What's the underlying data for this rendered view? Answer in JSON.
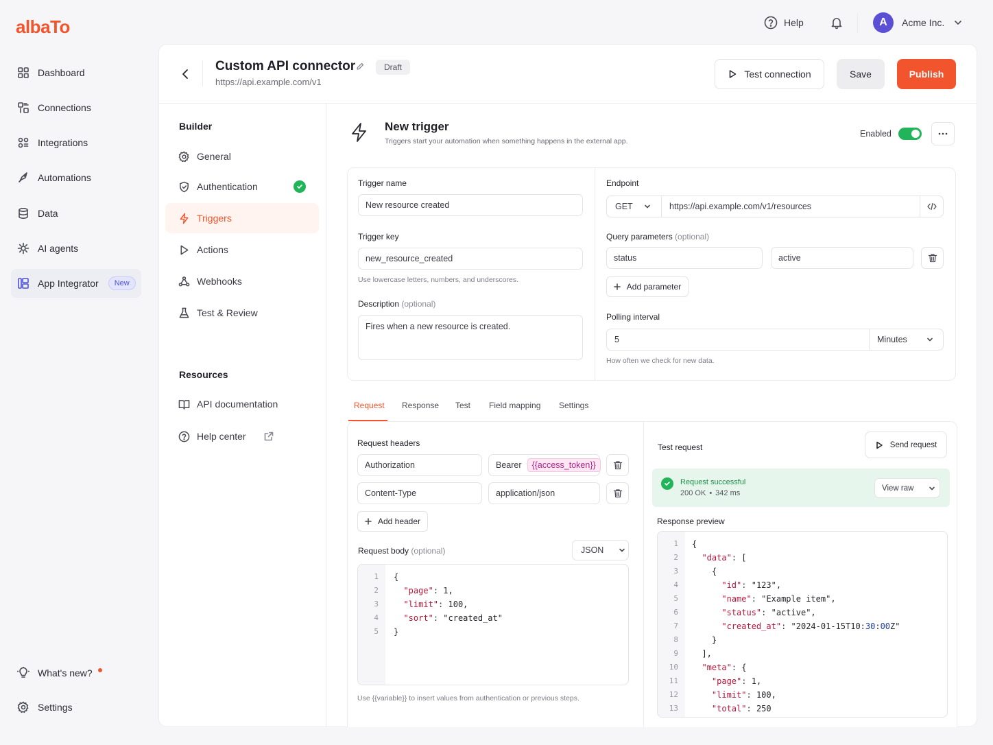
{
  "brand": {
    "logo": "albaTo",
    "accent": "#f2542d",
    "success": "#22b45a"
  },
  "topbar": {
    "help": "Help",
    "account": "Acme Inc.",
    "avatar_letter": "A"
  },
  "nav": {
    "items": [
      {
        "label": "Dashboard",
        "icon": "grid-icon"
      },
      {
        "label": "Connections",
        "icon": "connections-icon"
      },
      {
        "label": "Integrations",
        "icon": "integrations-icon"
      },
      {
        "label": "Automations",
        "icon": "rocket-icon"
      },
      {
        "label": "Data",
        "icon": "database-icon"
      },
      {
        "label": "AI agents",
        "icon": "ai-icon"
      },
      {
        "label": "App Integrator",
        "icon": "app-integrator-icon",
        "badge": "New"
      }
    ],
    "whats_new": "What's new?",
    "settings": "Settings"
  },
  "header": {
    "title": "Custom API connector",
    "url": "https://api.example.com/v1",
    "status": "Draft",
    "test_connection": "Test connection",
    "save": "Save",
    "publish": "Publish"
  },
  "builder": {
    "title": "Builder",
    "items": [
      "General",
      "Authentication",
      "Triggers",
      "Actions",
      "Webhooks",
      "Test & Review"
    ],
    "resources_title": "Resources",
    "resources": [
      "API documentation",
      "Help center"
    ]
  },
  "trigger": {
    "title": "New trigger",
    "subtitle": "Triggers start your automation when something happens in the external app.",
    "enabled_label": "Enabled",
    "name_label": "Trigger name",
    "name_value": "New resource created",
    "key_label": "Trigger key",
    "key_value": "new_resource_created",
    "key_hint": "Use lowercase letters, numbers, and underscores.",
    "desc_label": "Description",
    "optional": "(optional)",
    "desc_value": "Fires when a new resource is created.",
    "endpoint_label": "Endpoint",
    "method": "GET",
    "endpoint_url": "https://api.example.com/v1/resources",
    "query_label": "Query parameters",
    "query_key": "status",
    "query_value": "active",
    "add_parameter": "Add parameter",
    "polling_label": "Polling interval",
    "polling_value": "5",
    "polling_unit": "Minutes",
    "polling_hint": "How often we check for new data."
  },
  "tabs": [
    "Request",
    "Response",
    "Test",
    "Field mapping",
    "Settings"
  ],
  "request": {
    "headers_label": "Request headers",
    "headers": [
      {
        "key": "Authorization",
        "value": "Bearer",
        "token": "{{access_token}}"
      },
      {
        "key": "Content-Type",
        "value": "application/json",
        "token": ""
      }
    ],
    "add_header": "Add header",
    "body_label": "Request body",
    "body_format": "JSON",
    "body_lines": [
      "{",
      "  \"page\": 1,",
      "  \"limit\": 100,",
      "  \"sort\": \"created_at\"",
      "}"
    ],
    "variable_hint": "Use {{variable}} to insert values from authentication or previous steps."
  },
  "test": {
    "title": "Test request",
    "send": "Send request",
    "success_title": "Request successful",
    "success_status": "200 OK",
    "success_time": "342 ms",
    "view_raw": "View raw",
    "preview_label": "Response preview",
    "preview_lines": [
      "{",
      "  \"data\": [",
      "    {",
      "      \"id\": \"123\",",
      "      \"name\": \"Example item\",",
      "      \"status\": \"active\",",
      "      \"created_at\": \"2024-01-15T10:30:00Z\"",
      "    }",
      "  ],",
      "  \"meta\": {",
      "    \"page\": 1,",
      "    \"limit\": 100,",
      "    \"total\": 250"
    ]
  }
}
